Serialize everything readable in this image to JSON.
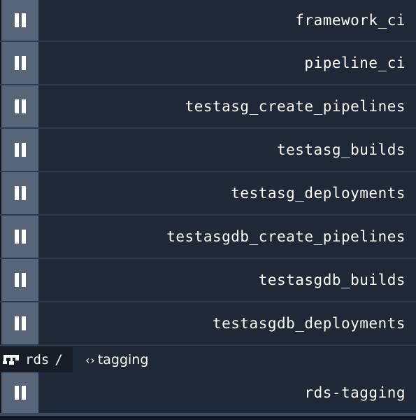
{
  "pipelines": [
    {
      "name": "framework_ci"
    },
    {
      "name": "pipeline_ci"
    },
    {
      "name": "testasg_create_pipelines"
    },
    {
      "name": "testasg_builds"
    },
    {
      "name": "testasg_deployments"
    },
    {
      "name": "testasgdb_create_pipelines"
    },
    {
      "name": "testasgdb_builds"
    },
    {
      "name": "testasgdb_deployments"
    }
  ],
  "group": {
    "icon": "pipeline-group-icon",
    "name": "rds",
    "separator": "/",
    "tag_icon": "code-icon",
    "tag": "tagging",
    "pipelines": [
      {
        "name": "rds-tagging"
      }
    ]
  },
  "icons": {
    "pause": "pause-icon"
  },
  "colors": {
    "background": "#1e2836",
    "pause_button": "#566577",
    "divider": "#2c3a4d",
    "text": "#ffffff"
  }
}
